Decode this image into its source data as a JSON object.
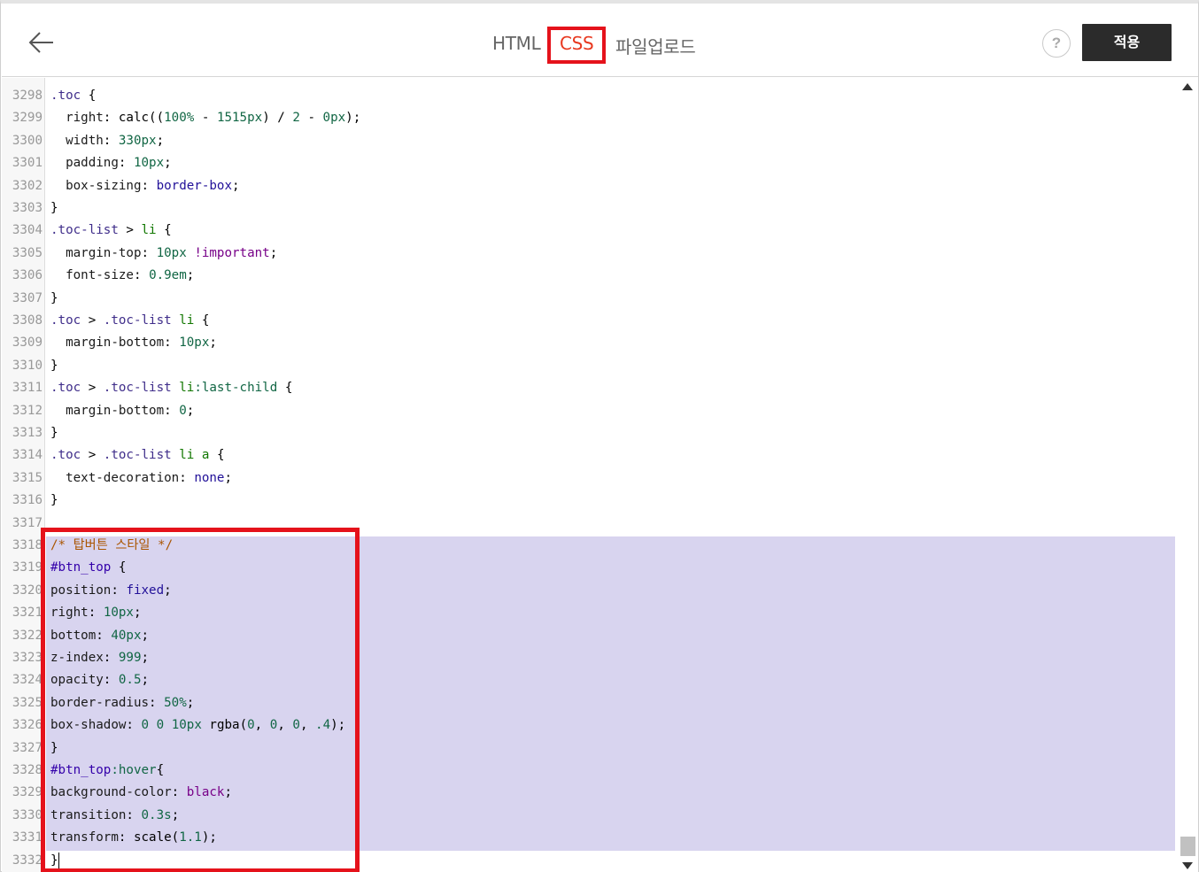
{
  "header": {
    "back_icon": "arrow-left-icon",
    "tabs": [
      {
        "label": "HTML"
      },
      {
        "label": "CSS"
      },
      {
        "label": "파일업로드"
      }
    ],
    "active_tab": "CSS",
    "help_label": "?",
    "apply_label": "적용"
  },
  "colors": {
    "active_tab": "#e8381f",
    "annotation_box": "#e5121b",
    "selection": "#d8d4ef",
    "apply_button": "#2b2b2b"
  },
  "editor": {
    "selected_lines": "3318-3331",
    "lines": [
      {
        "n": "3298",
        "tokens": [
          {
            "t": ".toc",
            "c": "sel"
          },
          {
            "t": " {",
            "c": ""
          }
        ]
      },
      {
        "n": "3299",
        "tokens": [
          {
            "t": "  right",
            "c": "prop"
          },
          {
            "t": ": calc((",
            "c": ""
          },
          {
            "t": "100%",
            "c": "num"
          },
          {
            "t": " - ",
            "c": ""
          },
          {
            "t": "1515px",
            "c": "num"
          },
          {
            "t": ") / ",
            "c": ""
          },
          {
            "t": "2",
            "c": "num"
          },
          {
            "t": " - ",
            "c": ""
          },
          {
            "t": "0px",
            "c": "num"
          },
          {
            "t": ");",
            "c": ""
          }
        ]
      },
      {
        "n": "3300",
        "tokens": [
          {
            "t": "  width",
            "c": "prop"
          },
          {
            "t": ": ",
            "c": ""
          },
          {
            "t": "330px",
            "c": "num"
          },
          {
            "t": ";",
            "c": ""
          }
        ]
      },
      {
        "n": "3301",
        "tokens": [
          {
            "t": "  padding",
            "c": "prop"
          },
          {
            "t": ": ",
            "c": ""
          },
          {
            "t": "10px",
            "c": "num"
          },
          {
            "t": ";",
            "c": ""
          }
        ]
      },
      {
        "n": "3302",
        "tokens": [
          {
            "t": "  box-sizing",
            "c": "prop"
          },
          {
            "t": ": ",
            "c": ""
          },
          {
            "t": "border-box",
            "c": "str"
          },
          {
            "t": ";",
            "c": ""
          }
        ]
      },
      {
        "n": "3303",
        "tokens": [
          {
            "t": "}",
            "c": ""
          }
        ]
      },
      {
        "n": "3304",
        "tokens": [
          {
            "t": ".toc-list",
            "c": "sel"
          },
          {
            "t": " > ",
            "c": ""
          },
          {
            "t": "li",
            "c": "tag"
          },
          {
            "t": " {",
            "c": ""
          }
        ]
      },
      {
        "n": "3305",
        "tokens": [
          {
            "t": "  margin-top",
            "c": "prop"
          },
          {
            "t": ": ",
            "c": ""
          },
          {
            "t": "10px",
            "c": "num"
          },
          {
            "t": " ",
            "c": ""
          },
          {
            "t": "!important",
            "c": "kw"
          },
          {
            "t": ";",
            "c": ""
          }
        ]
      },
      {
        "n": "3306",
        "tokens": [
          {
            "t": "  font-size",
            "c": "prop"
          },
          {
            "t": ": ",
            "c": ""
          },
          {
            "t": "0.9em",
            "c": "num"
          },
          {
            "t": ";",
            "c": ""
          }
        ]
      },
      {
        "n": "3307",
        "tokens": [
          {
            "t": "}",
            "c": ""
          }
        ]
      },
      {
        "n": "3308",
        "tokens": [
          {
            "t": ".toc",
            "c": "sel"
          },
          {
            "t": " > ",
            "c": ""
          },
          {
            "t": ".toc-list",
            "c": "sel"
          },
          {
            "t": " ",
            "c": ""
          },
          {
            "t": "li",
            "c": "tag"
          },
          {
            "t": " {",
            "c": ""
          }
        ]
      },
      {
        "n": "3309",
        "tokens": [
          {
            "t": "  margin-bottom",
            "c": "prop"
          },
          {
            "t": ": ",
            "c": ""
          },
          {
            "t": "10px",
            "c": "num"
          },
          {
            "t": ";",
            "c": ""
          }
        ]
      },
      {
        "n": "3310",
        "tokens": [
          {
            "t": "}",
            "c": ""
          }
        ]
      },
      {
        "n": "3311",
        "tokens": [
          {
            "t": ".toc",
            "c": "sel"
          },
          {
            "t": " > ",
            "c": ""
          },
          {
            "t": ".toc-list",
            "c": "sel"
          },
          {
            "t": " ",
            "c": ""
          },
          {
            "t": "li",
            "c": "tag"
          },
          {
            "t": ":last-child",
            "c": "num"
          },
          {
            "t": " {",
            "c": ""
          }
        ]
      },
      {
        "n": "3312",
        "tokens": [
          {
            "t": "  margin-bottom",
            "c": "prop"
          },
          {
            "t": ": ",
            "c": ""
          },
          {
            "t": "0",
            "c": "num"
          },
          {
            "t": ";",
            "c": ""
          }
        ]
      },
      {
        "n": "3313",
        "tokens": [
          {
            "t": "}",
            "c": ""
          }
        ]
      },
      {
        "n": "3314",
        "tokens": [
          {
            "t": ".toc",
            "c": "sel"
          },
          {
            "t": " > ",
            "c": ""
          },
          {
            "t": ".toc-list",
            "c": "sel"
          },
          {
            "t": " ",
            "c": ""
          },
          {
            "t": "li",
            "c": "tag"
          },
          {
            "t": " ",
            "c": ""
          },
          {
            "t": "a",
            "c": "tag"
          },
          {
            "t": " {",
            "c": ""
          }
        ]
      },
      {
        "n": "3315",
        "tokens": [
          {
            "t": "  text-decoration",
            "c": "prop"
          },
          {
            "t": ": ",
            "c": ""
          },
          {
            "t": "none",
            "c": "str"
          },
          {
            "t": ";",
            "c": ""
          }
        ]
      },
      {
        "n": "3316",
        "tokens": [
          {
            "t": "}",
            "c": ""
          }
        ]
      },
      {
        "n": "3317",
        "tokens": []
      },
      {
        "n": "3318",
        "tokens": [
          {
            "t": "/* 탑버튼 스타일 */",
            "c": "comment"
          }
        ]
      },
      {
        "n": "3319",
        "tokens": [
          {
            "t": "#btn_top",
            "c": "id"
          },
          {
            "t": " {",
            "c": ""
          }
        ]
      },
      {
        "n": "3320",
        "tokens": [
          {
            "t": "position",
            "c": "prop"
          },
          {
            "t": ": ",
            "c": ""
          },
          {
            "t": "fixed",
            "c": "str"
          },
          {
            "t": ";",
            "c": ""
          }
        ]
      },
      {
        "n": "3321",
        "tokens": [
          {
            "t": "right",
            "c": "prop"
          },
          {
            "t": ": ",
            "c": ""
          },
          {
            "t": "10px",
            "c": "num"
          },
          {
            "t": ";",
            "c": ""
          }
        ]
      },
      {
        "n": "3322",
        "tokens": [
          {
            "t": "bottom",
            "c": "prop"
          },
          {
            "t": ": ",
            "c": ""
          },
          {
            "t": "40px",
            "c": "num"
          },
          {
            "t": ";",
            "c": ""
          }
        ]
      },
      {
        "n": "3323",
        "tokens": [
          {
            "t": "z-index",
            "c": "prop"
          },
          {
            "t": ": ",
            "c": ""
          },
          {
            "t": "999",
            "c": "num"
          },
          {
            "t": ";",
            "c": ""
          }
        ]
      },
      {
        "n": "3324",
        "tokens": [
          {
            "t": "opacity",
            "c": "prop"
          },
          {
            "t": ": ",
            "c": ""
          },
          {
            "t": "0.5",
            "c": "num"
          },
          {
            "t": ";",
            "c": ""
          }
        ]
      },
      {
        "n": "3325",
        "tokens": [
          {
            "t": "border-radius",
            "c": "prop"
          },
          {
            "t": ": ",
            "c": ""
          },
          {
            "t": "50%",
            "c": "num"
          },
          {
            "t": ";",
            "c": ""
          }
        ]
      },
      {
        "n": "3326",
        "tokens": [
          {
            "t": "box-shadow",
            "c": "prop"
          },
          {
            "t": ": ",
            "c": ""
          },
          {
            "t": "0",
            "c": "num"
          },
          {
            "t": " ",
            "c": ""
          },
          {
            "t": "0",
            "c": "num"
          },
          {
            "t": " ",
            "c": ""
          },
          {
            "t": "10px",
            "c": "num"
          },
          {
            "t": " rgba(",
            "c": ""
          },
          {
            "t": "0",
            "c": "num"
          },
          {
            "t": ", ",
            "c": ""
          },
          {
            "t": "0",
            "c": "num"
          },
          {
            "t": ", ",
            "c": ""
          },
          {
            "t": "0",
            "c": "num"
          },
          {
            "t": ", ",
            "c": ""
          },
          {
            "t": ".4",
            "c": "num"
          },
          {
            "t": ");",
            "c": ""
          }
        ]
      },
      {
        "n": "3327",
        "tokens": [
          {
            "t": "}",
            "c": ""
          }
        ]
      },
      {
        "n": "3328",
        "tokens": [
          {
            "t": "#btn_top",
            "c": "id"
          },
          {
            "t": ":hover",
            "c": "num"
          },
          {
            "t": "{",
            "c": ""
          }
        ]
      },
      {
        "n": "3329",
        "tokens": [
          {
            "t": "background-color",
            "c": "prop"
          },
          {
            "t": ": ",
            "c": ""
          },
          {
            "t": "black",
            "c": "kw"
          },
          {
            "t": ";",
            "c": ""
          }
        ]
      },
      {
        "n": "3330",
        "tokens": [
          {
            "t": "transition",
            "c": "prop"
          },
          {
            "t": ": ",
            "c": ""
          },
          {
            "t": "0.3s",
            "c": "num"
          },
          {
            "t": ";",
            "c": ""
          }
        ]
      },
      {
        "n": "3331",
        "tokens": [
          {
            "t": "transform",
            "c": "prop"
          },
          {
            "t": ": scale(",
            "c": ""
          },
          {
            "t": "1.1",
            "c": "num"
          },
          {
            "t": ");",
            "c": ""
          }
        ]
      },
      {
        "n": "3332",
        "tokens": [
          {
            "t": "}",
            "c": ""
          }
        ]
      }
    ]
  }
}
